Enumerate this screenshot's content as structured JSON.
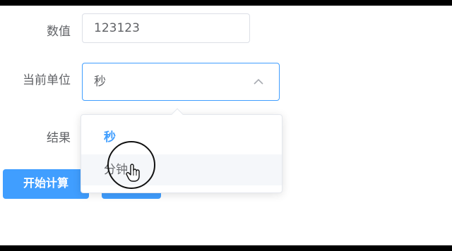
{
  "form": {
    "value_label": "数值",
    "value_input": "123123",
    "unit_label": "当前单位",
    "unit_selected": "秒",
    "result_label": "结果",
    "result_value": ""
  },
  "dropdown": {
    "options": [
      {
        "label": "秒",
        "state": "selected"
      },
      {
        "label": "分钟",
        "state": "hover"
      }
    ]
  },
  "buttons": {
    "start_label": "开始计算",
    "second_label": ""
  },
  "colors": {
    "primary": "#409eff",
    "border": "#dcdfe6",
    "text": "#606266",
    "hover_bg": "#f5f7fa"
  },
  "icons": {
    "select_arrow": "chevron-up-icon",
    "cursor": "hand-pointer-icon"
  }
}
